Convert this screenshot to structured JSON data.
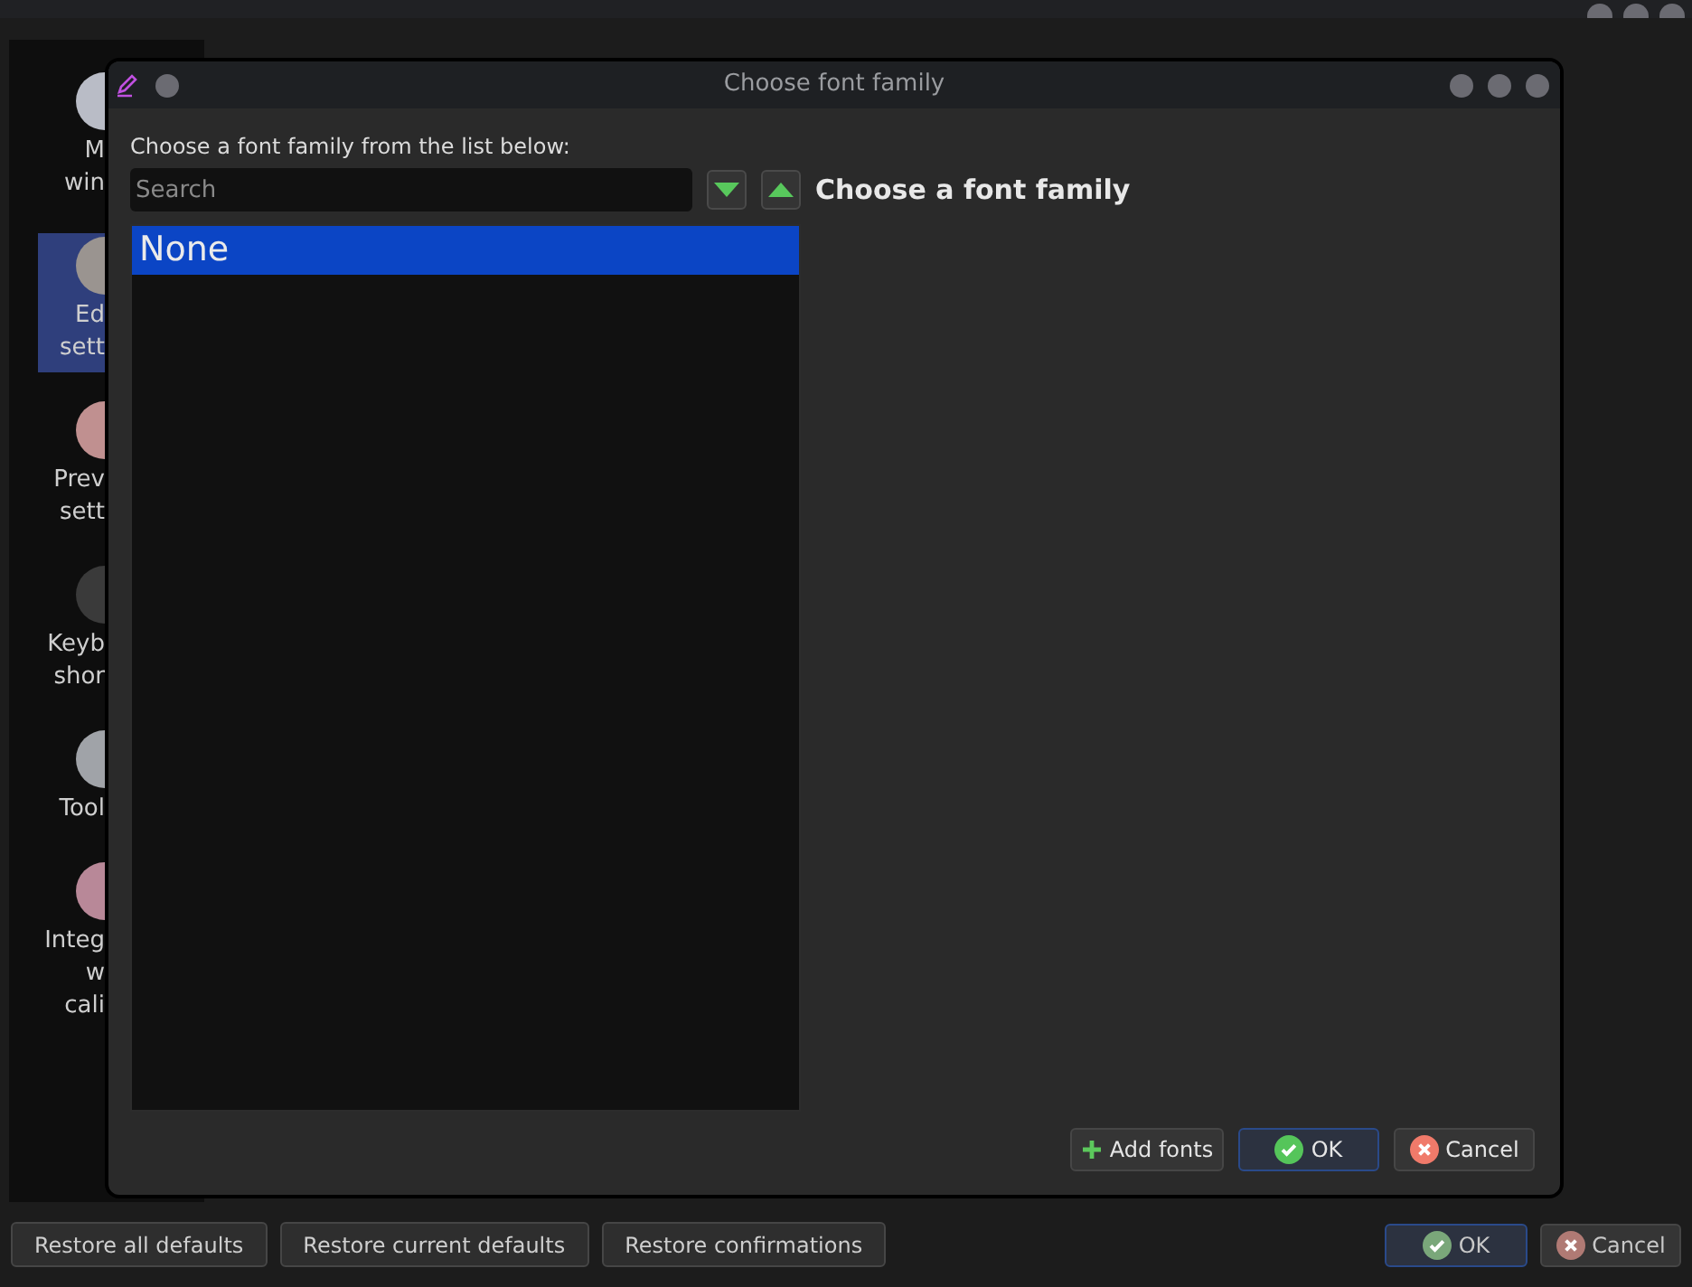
{
  "sidebar": {
    "items": [
      {
        "lines": [
          "M",
          "win"
        ],
        "selected": false,
        "color": "#b9bcc6"
      },
      {
        "lines": [
          "Ed",
          "sett"
        ],
        "selected": true,
        "color": "#9a9490"
      },
      {
        "lines": [
          "Prev",
          "sett"
        ],
        "selected": false,
        "color": "#c09090"
      },
      {
        "lines": [
          "Keyb",
          "shor"
        ],
        "selected": false,
        "color": "#3a3a3a"
      },
      {
        "lines": [
          "Tool"
        ],
        "selected": false,
        "color": "#a0a3a8"
      },
      {
        "lines": [
          "Integ",
          "w",
          "cali"
        ],
        "selected": false,
        "color": "#b88898"
      }
    ]
  },
  "dialog": {
    "title": "Choose font family",
    "prompt": "Choose a font family from the list below:",
    "search": {
      "placeholder": "Search"
    },
    "heading": "Choose a font family",
    "fonts": [
      {
        "name": "None",
        "selected": true
      }
    ],
    "buttons": [
      {
        "kind": "add",
        "label": "Add fonts",
        "default": false
      },
      {
        "kind": "ok",
        "label": "OK",
        "default": true
      },
      {
        "kind": "cancel",
        "label": "Cancel",
        "default": false
      }
    ]
  },
  "footer": {
    "left_buttons": [
      "Restore all defaults",
      "Restore current defaults",
      "Restore confirmations"
    ],
    "right_buttons": [
      {
        "kind": "ok",
        "label": "OK",
        "default": true
      },
      {
        "kind": "cancel",
        "label": "Cancel",
        "default": false
      }
    ]
  }
}
